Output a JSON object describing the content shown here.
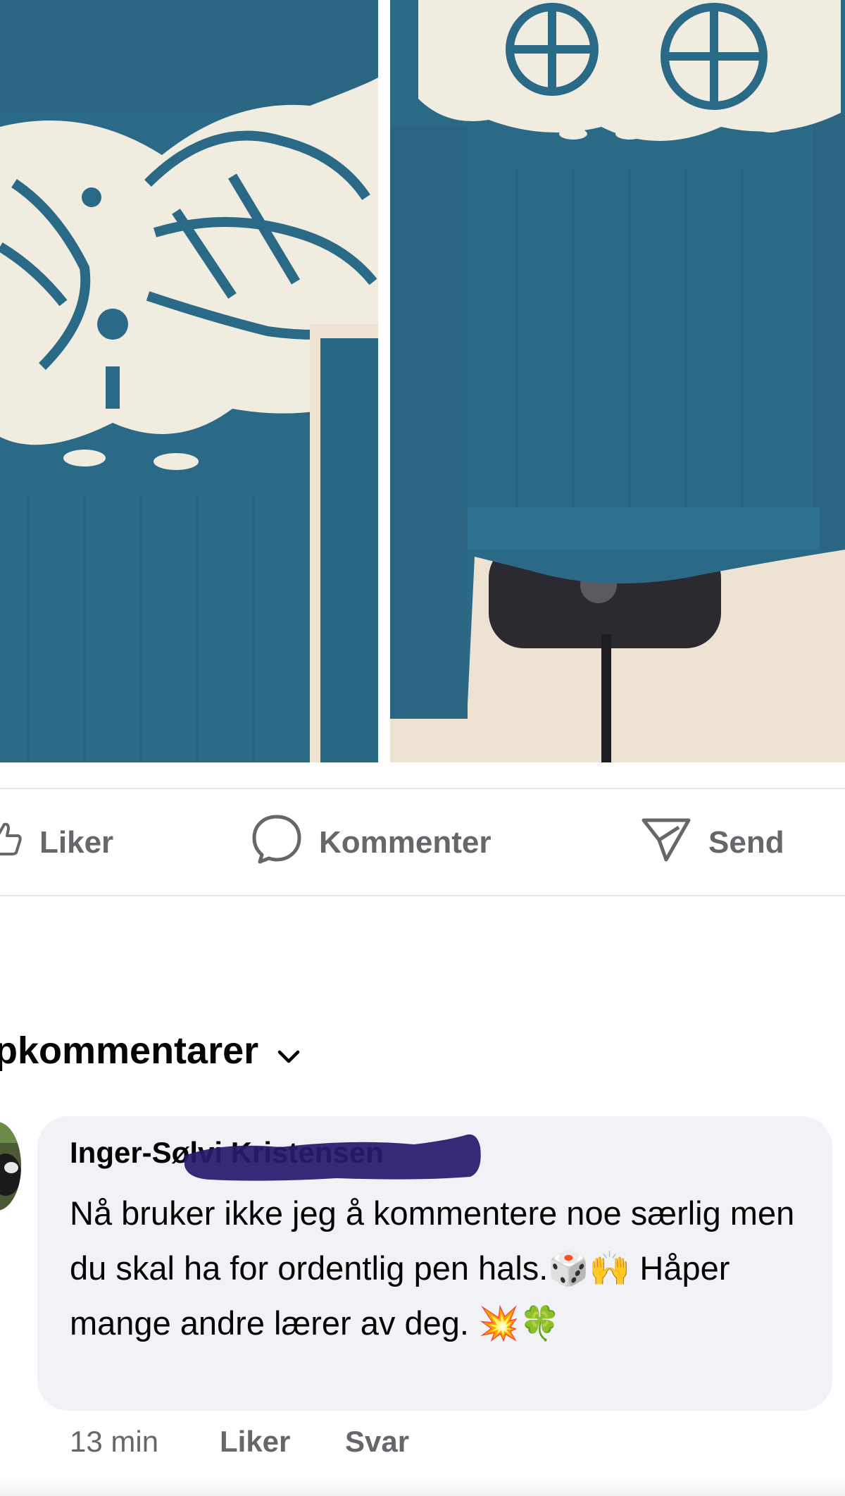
{
  "post": {
    "photos": [
      {
        "name": "sweater-closeup-photo"
      },
      {
        "name": "sweater-mannequin-photo"
      }
    ],
    "colors": {
      "sweater_blue": "#2b6a87",
      "pattern_cream": "#f1ece0",
      "wall_beige": "#eee2d2",
      "mannequin_dark": "#2b2a30"
    }
  },
  "actions": {
    "like_label": "Liker",
    "comment_label": "Kommenter",
    "send_label": "Send",
    "like_icon": "thumbs-up-icon",
    "comment_icon": "speech-bubble-icon",
    "send_icon": "send-icon"
  },
  "comments": {
    "header": "Toppkommentarer",
    "header_visible": "pkommentarer",
    "header_icon": "chevron-down-icon",
    "items": [
      {
        "author": "Inger-Sølvi Kristensen",
        "text": "Nå bruker ikke jeg å kommentere noe særlig men du skal ha for ordentlig  pen hals.🎲🙌 Håper mange andre lærer av deg. 💥🍀",
        "time": "13 min",
        "like_label": "Liker",
        "reply_label": "Svar"
      }
    ]
  },
  "colors": {
    "text_primary": "#050505",
    "text_secondary": "#65676b",
    "bubble_bg": "#f0f2f5",
    "divider": "#e4e6eb",
    "redaction": "#2a1a6e"
  }
}
